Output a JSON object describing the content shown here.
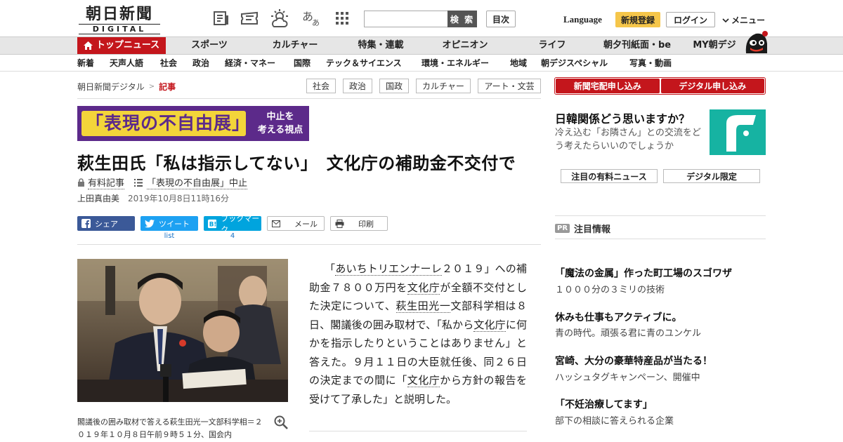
{
  "header": {
    "logo_jp": "朝日新聞",
    "logo_en": "DIGITAL",
    "search_button": "検 索",
    "index_button": "目次",
    "language": "Language",
    "register": "新規登録",
    "login": "ログイン",
    "menu": "メニュー"
  },
  "main_nav": [
    "トップニュース",
    "スポーツ",
    "カルチャー",
    "特集・連載",
    "オピニオン",
    "ライフ",
    "朝夕刊紙面・be",
    "MY朝デジ"
  ],
  "sub_nav": [
    "新着",
    "天声人語",
    "社会",
    "政治",
    "経済・マネー",
    "国際",
    "テック＆サイエンス",
    "環境・エネルギー",
    "地域",
    "朝デジスペシャル",
    "写真・動画"
  ],
  "breadcrumb": {
    "home": "朝日新聞デジタル",
    "sep": ">",
    "current": "記事"
  },
  "tags": [
    "社会",
    "政治",
    "国政",
    "カルチャー",
    "アート・文芸"
  ],
  "banner": {
    "main": "「表現の不自由展」",
    "side_line1": "中止を",
    "side_line2": "考える視点"
  },
  "article": {
    "headline": "萩生田氏「私は指示してない」　文化庁の補助金不交付で",
    "paid_label": "有料記事",
    "series_label": "「表現の不自由展」中止",
    "author": "上田真由美",
    "date": "2019年10月8日11時16分",
    "body_parts": [
      "「",
      "あいちトリエンナーレ",
      "２０１９」への補助金７８００万円を",
      "文化庁",
      "が全額不交付とした決定について、",
      "萩生田光一",
      "文部科学相は８日、閣議後の囲み取材で、「私から",
      "文化庁",
      "に何かを指示したりということはありません」と答えた。９月１１日の大臣就任後、同２６日の決定までの間に「",
      "文化庁",
      "から方針の報告を受けて了承した」と説明した。"
    ],
    "caption": "閣議後の囲み取材で答える萩生田光一文部科学相＝２０１９年１０月８日午前９時５１分、国会内"
  },
  "share": {
    "facebook": "シェア",
    "twitter": "ツイート",
    "twitter_count": "list",
    "hatena": "ブックマーク",
    "hatena_count": "4",
    "mail": "メール",
    "print": "印刷"
  },
  "sidebar": {
    "subscribe_paper": "新聞宅配申し込み",
    "subscribe_digital": "デジタル申し込み",
    "promo_title": "日韓関係どう思いますか？",
    "promo_desc": "冷え込む「お隣さん」との交流をどう考えたらいいのでしょうか",
    "tab_paid": "注目の有料ニュース",
    "tab_digital": "デジタル限定",
    "pr_badge": "PR",
    "pr_label": "注目情報",
    "ads": [
      {
        "title": "「魔法の金属」作った町工場のスゴワザ",
        "desc": "１０００分の３ミリの技術"
      },
      {
        "title": "休みも仕事もアクティブに。",
        "desc": "青の時代。頑張る君に青のユンケル"
      },
      {
        "title": "宮崎、大分の豪華特産品が当たる！",
        "desc": "ハッシュタグキャンペーン、開催中"
      },
      {
        "title": "「不妊治療してます」",
        "desc": "部下の相談に答えられる企業"
      }
    ]
  },
  "colors": {
    "brand_red": "#c4161c",
    "banner_purple": "#5c2a8a",
    "banner_yellow": "#f3d53a",
    "teal": "#16b3a2"
  }
}
